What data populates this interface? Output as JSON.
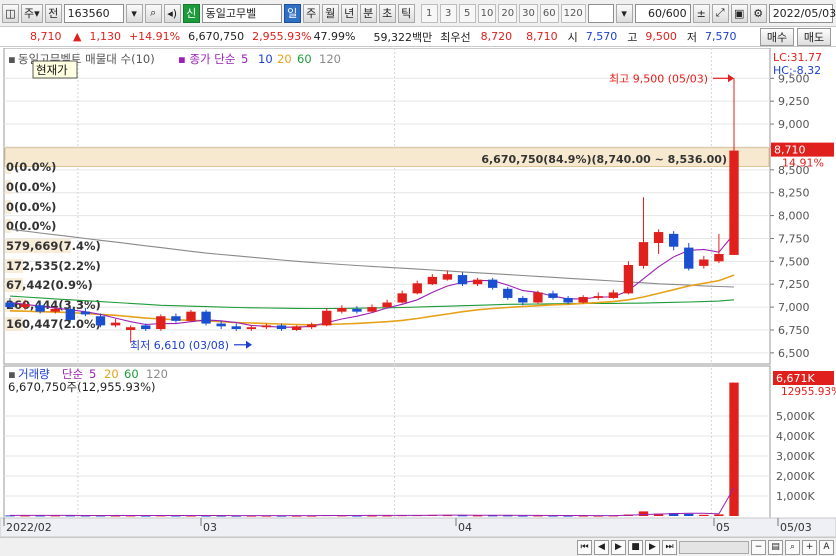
{
  "toolbar": {
    "market_type": "주",
    "prev_label": "전",
    "stock_code": "163560",
    "new_badge": "신",
    "stock_name": "동일고무벨",
    "periods": [
      "일",
      "주",
      "월",
      "년",
      "분",
      "초",
      "틱"
    ],
    "active_period": "일",
    "intervals": [
      "1",
      "3",
      "5",
      "10",
      "20",
      "30",
      "60",
      "120"
    ],
    "count": "60/600",
    "date": "2022/05/03"
  },
  "quote": {
    "price": "8,710",
    "change": "1,130",
    "change_pct": "+14.91%",
    "volume": "6,670,750",
    "volume_ratio": "2,955.93%",
    "turnover": "47.99%",
    "amount": "59,322백만",
    "best_label": "최우선",
    "best_ask": "8,720",
    "best_bid": "8,710",
    "open_label": "시",
    "open": "7,570",
    "high_label": "고",
    "high": "9,500",
    "low_label": "저",
    "low": "7,570",
    "buy_label": "매수",
    "sell_label": "매도"
  },
  "price_panel": {
    "legend_prefix": "동일고무벨트 매물대 수(10)",
    "legend_ma": "종가 단순",
    "ma_periods": [
      "5",
      "10",
      "20",
      "60",
      "120"
    ],
    "ma_colors": [
      "#9b1fb5",
      "#1c3fd6",
      "#e6a21b",
      "#1f9b3a",
      "#8a8a8a"
    ],
    "tooltip": "현재가",
    "lc_label": "LC:31.77",
    "hc_label": "HC:-8.32",
    "high_marker": "최고 9,500 (05/03)",
    "low_marker": "최저 6,610 (03/08)",
    "volume_profile_label": "6,670,750(84.9%)(8,740.00 ~ 8,536.00)",
    "current_price_tag": "8,710",
    "current_pct_tag": "14.91%",
    "profile_labels": [
      "0(0.0%)",
      "0(0.0%)",
      "0(0.0%)",
      "0(0.0%)",
      "579,669(7.4%)",
      "172,535(2.2%)",
      "67,442(0.9%)",
      "260,444(3.3%)",
      "160,447(2.0%)"
    ]
  },
  "volume_panel": {
    "legend_title": "거래량",
    "legend_ma": "단순",
    "ma_periods": [
      "5",
      "20",
      "60",
      "120"
    ],
    "summary": "6,670,750주(12,955.93%)",
    "current_tag": "6,671K",
    "current_pct_tag": "12955.93%"
  },
  "x_labels": [
    "2022/02",
    "03",
    "04",
    "05",
    "05/03"
  ],
  "colors": {
    "up": "#e0201c",
    "down": "#1b4fd1",
    "bg": "#ffffff",
    "grid": "#e6e6e6"
  },
  "chart_data": {
    "type": "candlestick",
    "x": [
      "02/22",
      "02/23",
      "02/24",
      "02/25",
      "02/28",
      "03/02",
      "03/03",
      "03/04",
      "03/07",
      "03/08",
      "03/10",
      "03/11",
      "03/14",
      "03/15",
      "03/16",
      "03/17",
      "03/18",
      "03/21",
      "03/22",
      "03/23",
      "03/24",
      "03/25",
      "03/28",
      "03/29",
      "03/30",
      "03/31",
      "04/01",
      "04/04",
      "04/05",
      "04/06",
      "04/07",
      "04/08",
      "04/11",
      "04/12",
      "04/13",
      "04/14",
      "04/15",
      "04/18",
      "04/19",
      "04/20",
      "04/21",
      "04/22",
      "04/25",
      "04/26",
      "04/27",
      "04/28",
      "04/29",
      "05/02",
      "05/03"
    ],
    "open": [
      7050,
      7000,
      7020,
      6950,
      6980,
      6950,
      6900,
      6800,
      6750,
      6800,
      6760,
      6900,
      6850,
      6950,
      6820,
      6790,
      6760,
      6780,
      6800,
      6750,
      6780,
      6800,
      6950,
      6980,
      6950,
      7000,
      7050,
      7150,
      7250,
      7300,
      7350,
      7250,
      7300,
      7200,
      7100,
      7050,
      7150,
      7100,
      7050,
      7100,
      7100,
      7150,
      7450,
      7700,
      7800,
      7650,
      7450,
      7500,
      7570
    ],
    "close": [
      7000,
      7030,
      6950,
      6980,
      6860,
      6920,
      6800,
      6830,
      6780,
      6760,
      6900,
      6850,
      6950,
      6820,
      6790,
      6760,
      6780,
      6800,
      6760,
      6790,
      6810,
      6960,
      6990,
      6950,
      7000,
      7050,
      7150,
      7260,
      7330,
      7360,
      7250,
      7300,
      7210,
      7100,
      7050,
      7160,
      7100,
      7050,
      7110,
      7120,
      7160,
      7460,
      7710,
      7820,
      7660,
      7420,
      7520,
      7580,
      8710
    ],
    "high": [
      7100,
      7080,
      7060,
      7000,
      7000,
      6990,
      6930,
      6870,
      6800,
      6820,
      6920,
      6930,
      6970,
      6970,
      6850,
      6820,
      6800,
      6820,
      6820,
      6800,
      6830,
      6990,
      7020,
      7010,
      7030,
      7080,
      7180,
      7290,
      7360,
      7400,
      7380,
      7320,
      7320,
      7220,
      7120,
      7180,
      7180,
      7120,
      7130,
      7160,
      7190,
      7500,
      8200,
      7850,
      7830,
      7700,
      7560,
      7800,
      9500
    ],
    "low": [
      6980,
      6970,
      6930,
      6930,
      6840,
      6900,
      6780,
      6780,
      6610,
      6740,
      6740,
      6830,
      6840,
      6800,
      6760,
      6740,
      6740,
      6760,
      6740,
      6740,
      6760,
      6790,
      6930,
      6930,
      6940,
      6990,
      7040,
      7140,
      7240,
      7290,
      7230,
      7230,
      7190,
      7080,
      7020,
      7040,
      7080,
      7030,
      7040,
      7080,
      7090,
      7140,
      7420,
      7580,
      7620,
      7400,
      7420,
      7480,
      7570
    ],
    "volume": [
      30,
      28,
      26,
      30,
      28,
      25,
      25,
      24,
      27,
      22,
      30,
      24,
      24,
      22,
      20,
      18,
      20,
      20,
      18,
      18,
      20,
      45,
      30,
      22,
      24,
      28,
      40,
      45,
      55,
      45,
      35,
      30,
      30,
      30,
      22,
      28,
      22,
      20,
      22,
      20,
      28,
      75,
      230,
      120,
      150,
      110,
      60,
      80,
      6671
    ],
    "volume_unit": "K",
    "price_ylim": [
      6400,
      9700
    ],
    "price_ticks": [
      6500,
      6750,
      7000,
      7250,
      7500,
      7750,
      8000,
      8250,
      8500,
      8750,
      9000,
      9250,
      9500
    ],
    "volume_ylim": [
      0,
      6900
    ],
    "volume_ticks": [
      1000,
      2000,
      3000,
      4000,
      5000
    ],
    "volume_tick_labels": [
      "1,000K",
      "2,000K",
      "3,000K",
      "4,000K",
      "5,000K"
    ],
    "ma5": [
      7050,
      7030,
      7010,
      6990,
      6970,
      6950,
      6920,
      6880,
      6840,
      6810,
      6820,
      6820,
      6840,
      6860,
      6850,
      6830,
      6800,
      6790,
      6780,
      6780,
      6790,
      6830,
      6870,
      6900,
      6940,
      6990,
      7030,
      7080,
      7160,
      7230,
      7270,
      7290,
      7290,
      7240,
      7180,
      7160,
      7120,
      7090,
      7090,
      7110,
      7110,
      7180,
      7310,
      7440,
      7550,
      7620,
      7630,
      7600,
      7800
    ],
    "ma20": [
      6960,
      6955,
      6950,
      6945,
      6940,
      6930,
      6920,
      6910,
      6895,
      6880,
      6870,
      6862,
      6855,
      6850,
      6840,
      6832,
      6826,
      6820,
      6815,
      6810,
      6806,
      6810,
      6815,
      6822,
      6830,
      6840,
      6855,
      6875,
      6900,
      6925,
      6950,
      6970,
      6985,
      6995,
      7005,
      7015,
      7025,
      7030,
      7040,
      7050,
      7060,
      7080,
      7110,
      7150,
      7190,
      7230,
      7260,
      7290,
      7350
    ],
    "ma60": [
      7120,
      7110,
      7100,
      7090,
      7080,
      7070,
      7060,
      7050,
      7040,
      7030,
      7020,
      7015,
      7010,
      7005,
      7000,
      6995,
      6992,
      6990,
      6988,
      6986,
      6985,
      6985,
      6986,
      6988,
      6990,
      6992,
      6995,
      7000,
      7005,
      7010,
      7015,
      7020,
      7025,
      7030,
      7032,
      7034,
      7036,
      7038,
      7040,
      7040,
      7040,
      7042,
      7044,
      7048,
      7052,
      7056,
      7060,
      7065,
      7080
    ],
    "ma120": [
      7850,
      7830,
      7810,
      7790,
      7770,
      7750,
      7730,
      7710,
      7690,
      7670,
      7650,
      7630,
      7610,
      7590,
      7575,
      7560,
      7545,
      7530,
      7515,
      7500,
      7488,
      7476,
      7465,
      7455,
      7445,
      7435,
      7425,
      7415,
      7405,
      7395,
      7385,
      7375,
      7365,
      7355,
      7345,
      7335,
      7325,
      7315,
      7305,
      7295,
      7285,
      7275,
      7265,
      7255,
      7248,
      7240,
      7232,
      7225,
      7220
    ]
  }
}
